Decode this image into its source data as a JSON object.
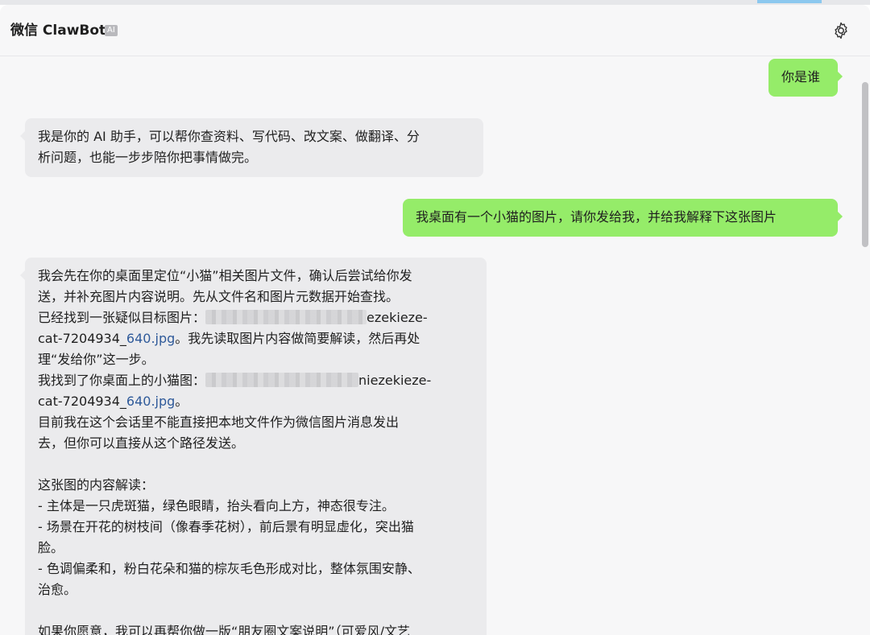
{
  "header": {
    "title": "微信 ClawBot",
    "badge": "AI",
    "settings_icon": "gear-icon"
  },
  "messages": [
    {
      "role": "me",
      "lines": [
        "你是谁"
      ]
    },
    {
      "role": "bot",
      "lines": [
        "我是你的 AI 助手，可以帮你查资料、写代码、改文案、做翻译、分",
        "析问题，也能一步步陪你把事情做完。"
      ]
    },
    {
      "role": "me",
      "lines": [
        "我桌面有一个小猫的图片，请你发给我，并给我解释下这张图片"
      ]
    },
    {
      "role": "bot",
      "l1": "我会先在你的桌面里定位“小猫”相关图片文件，确认后尝试给你发",
      "l2": "送，并补充图片内容说明。先从文件名和图片元数据开始查找。",
      "l3_prefix": "已经找到一张疑似目标图片：",
      "l3_suffix": "ezekieze-",
      "l4_prefix": "cat-7204934_",
      "l4_link": "640.jpg",
      "l4_suffix": "。我先读取图片内容做简要解读，然后再处",
      "l5": "理“发给你”这一步。",
      "l6_prefix": "我找到了你桌面上的小猫图：",
      "l6_suffix": "niezekieze-",
      "l7_prefix": "cat-7204934_",
      "l7_link": "640.jpg",
      "l7_suffix": "。",
      "l8": "目前我在这个会话里不能直接把本地文件作为微信图片消息发出",
      "l9": "去，但你可以直接从这个路径发送。",
      "l11": "这张图的内容解读：",
      "l12": "- 主体是一只虎斑猫，绿色眼睛，抬头看向上方，神态很专注。",
      "l13": "- 场景在开花的树枝间（像春季花树），前后景有明显虚化，突出猫",
      "l14": "脸。",
      "l15": "- 色调偏柔和，粉白花朵和猫的棕灰毛色形成对比，整体氛围安静、",
      "l16": "治愈。",
      "l18": "如果你愿意，我可以再帮你做一版“朋友圈文案说明”（可爱风/文艺"
    }
  ]
}
